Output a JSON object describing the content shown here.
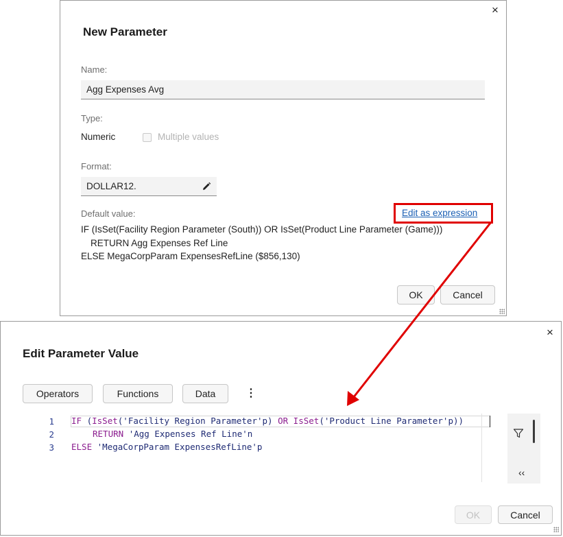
{
  "new_parameter_dialog": {
    "title": "New Parameter",
    "close_glyph": "×",
    "name_label": "Name:",
    "name_value": "Agg Expenses Avg",
    "type_label": "Type:",
    "type_value": "Numeric",
    "multiple_values_label": "Multiple values",
    "format_label": "Format:",
    "format_value": "DOLLAR12.",
    "default_value_label": "Default value:",
    "edit_expression_link": "Edit as expression",
    "default_lines": [
      "IF (IsSet(Facility Region Parameter (South)) OR IsSet(Product Line Parameter (Game)))",
      "RETURN Agg Expenses Ref Line",
      "ELSE MegaCorpParam ExpensesRefLine ($856,130)"
    ],
    "ok_label": "OK",
    "cancel_label": "Cancel"
  },
  "edit_parameter_dialog": {
    "title": "Edit Parameter Value",
    "close_glyph": "×",
    "tabs": [
      "Operators",
      "Functions",
      "Data"
    ],
    "more_glyph": "⋮",
    "line_numbers": [
      "1",
      "2",
      "3"
    ],
    "code": {
      "l1_if": "IF",
      "l1_a": " (",
      "l1_isset1": "IsSet",
      "l1_b": "(",
      "l1_str1": "'Facility Region Parameter'p",
      "l1_c": ") ",
      "l1_or": "OR",
      "l1_d": " ",
      "l1_isset2": "IsSet",
      "l1_e": "(",
      "l1_str2": "'Product Line Parameter'p",
      "l1_f": "))",
      "l2_return": "RETURN",
      "l2_str": "'Agg Expenses Ref Line'n",
      "l3_else": "ELSE",
      "l3_str": "'MegaCorpParam ExpensesRefLine'p"
    },
    "side_icons": {
      "filter": "filter-icon",
      "collapse": "collapse-icon"
    },
    "collapse_glyph": "‹‹",
    "ok_label": "OK",
    "cancel_label": "Cancel"
  },
  "colors": {
    "highlight": "#e00000",
    "link": "#1a5fb4",
    "keyword": "#8b1d8f",
    "string": "#1f2b74"
  }
}
